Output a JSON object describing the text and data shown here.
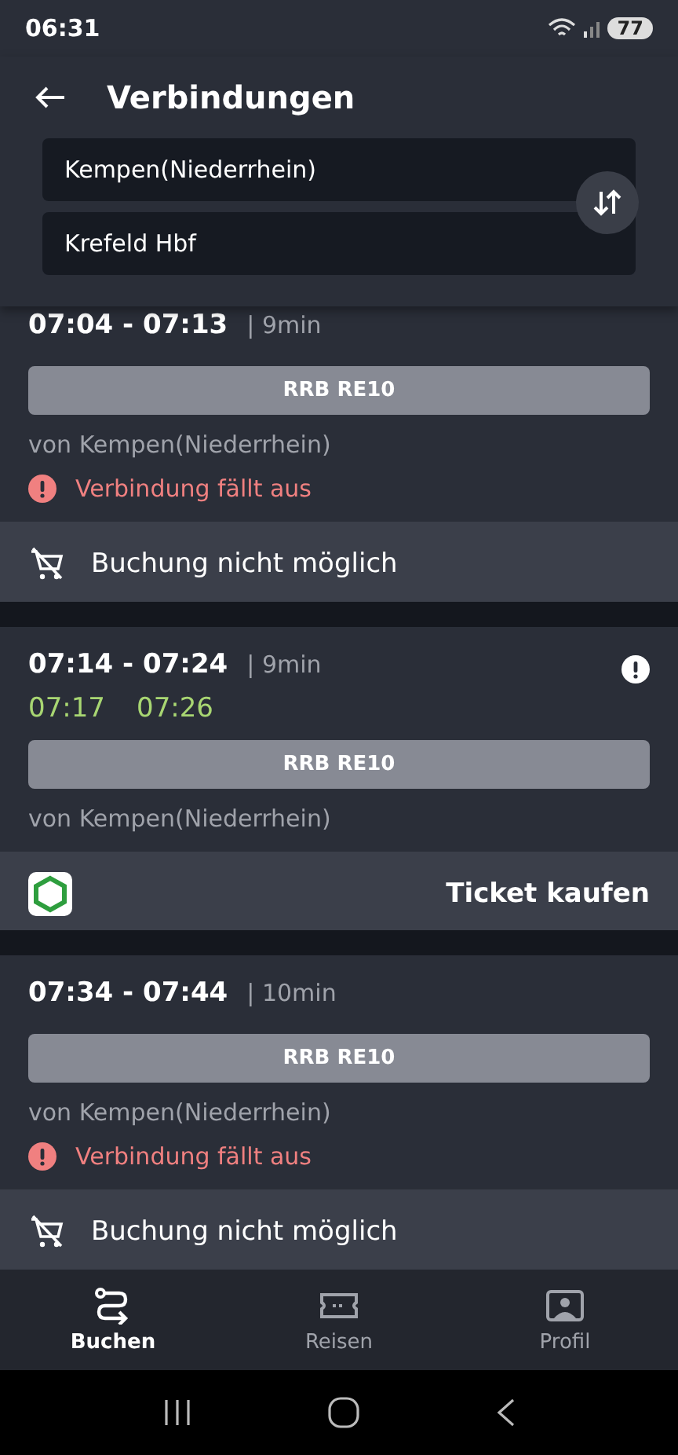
{
  "status_bar": {
    "time": "06:31",
    "battery": "77"
  },
  "header": {
    "title": "Verbindungen",
    "from": "Kempen(Niederrhein)",
    "to": "Krefeld Hbf"
  },
  "connections": [
    {
      "times": "07:04 - 07:13",
      "duration": "| 9min",
      "line": "RRB RE10",
      "origin": "von Kempen(Niederrhein)",
      "notice": "Verbindung fällt aus",
      "footer": {
        "kind": "unavailable",
        "label": "Buchung nicht möglich"
      }
    },
    {
      "times": "07:14 - 07:24",
      "duration": "| 9min",
      "alert": true,
      "realtime": [
        "07:17",
        "07:26"
      ],
      "line": "RRB RE10",
      "origin": "von Kempen(Niederrhein)",
      "footer": {
        "kind": "ticket",
        "label": "Ticket kaufen"
      }
    },
    {
      "times": "07:34 - 07:44",
      "duration": "| 10min",
      "line": "RRB RE10",
      "origin": "von Kempen(Niederrhein)",
      "notice": "Verbindung fällt aus",
      "footer": {
        "kind": "unavailable",
        "label": "Buchung nicht möglich"
      }
    }
  ],
  "nav": [
    {
      "label": "Buchen",
      "kind": "route",
      "selected": true
    },
    {
      "label": "Reisen",
      "kind": "ticket",
      "selected": false
    },
    {
      "label": "Profil",
      "kind": "profile",
      "selected": false
    }
  ]
}
